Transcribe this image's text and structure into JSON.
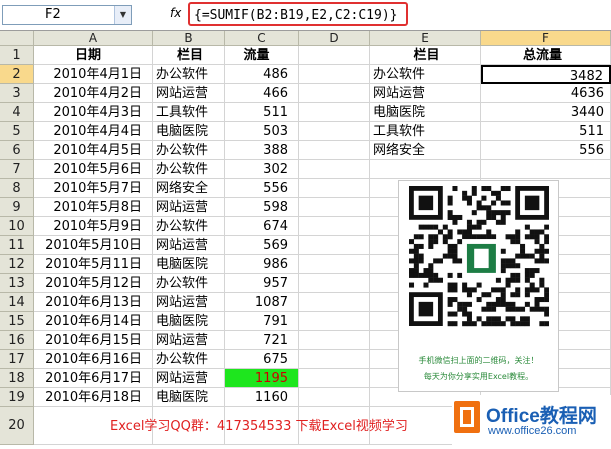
{
  "name_box": "F2",
  "fx_label": "fx",
  "formula": "{=SUMIF(B2:B19,E2,C2:C19)}",
  "columns": [
    "A",
    "B",
    "C",
    "D",
    "E",
    "F"
  ],
  "row_numbers": [
    "1",
    "2",
    "3",
    "4",
    "5",
    "6",
    "7",
    "8",
    "9",
    "10",
    "11",
    "12",
    "13",
    "14",
    "15",
    "16",
    "17",
    "18",
    "19",
    "20"
  ],
  "header_row": {
    "a": "日期",
    "b": "栏目",
    "c": "流量",
    "e": "栏目",
    "f": "总流量"
  },
  "rows": [
    {
      "a": "2010年4月1日",
      "b": "办公软件",
      "c": "486"
    },
    {
      "a": "2010年4月2日",
      "b": "网站运营",
      "c": "466"
    },
    {
      "a": "2010年4月3日",
      "b": "工具软件",
      "c": "511"
    },
    {
      "a": "2010年4月4日",
      "b": "电脑医院",
      "c": "503"
    },
    {
      "a": "2010年4月5日",
      "b": "办公软件",
      "c": "388"
    },
    {
      "a": "2010年5月6日",
      "b": "办公软件",
      "c": "302"
    },
    {
      "a": "2010年5月7日",
      "b": "网络安全",
      "c": "556"
    },
    {
      "a": "2010年5月8日",
      "b": "网站运营",
      "c": "598"
    },
    {
      "a": "2010年5月9日",
      "b": "办公软件",
      "c": "674"
    },
    {
      "a": "2010年5月10日",
      "b": "网站运营",
      "c": "569"
    },
    {
      "a": "2010年5月11日",
      "b": "电脑医院",
      "c": "986"
    },
    {
      "a": "2010年5月12日",
      "b": "办公软件",
      "c": "957"
    },
    {
      "a": "2010年6月13日",
      "b": "网站运营",
      "c": "1087"
    },
    {
      "a": "2010年6月14日",
      "b": "电脑医院",
      "c": "791"
    },
    {
      "a": "2010年6月15日",
      "b": "网站运营",
      "c": "721"
    },
    {
      "a": "2010年6月16日",
      "b": "办公软件",
      "c": "675"
    },
    {
      "a": "2010年6月17日",
      "b": "网站运营",
      "c": "1195"
    },
    {
      "a": "2010年6月18日",
      "b": "电脑医院",
      "c": "1160"
    }
  ],
  "summary": [
    {
      "e": "办公软件",
      "f": "3482"
    },
    {
      "e": "网站运营",
      "f": "4636"
    },
    {
      "e": "电脑医院",
      "f": "3440"
    },
    {
      "e": "工具软件",
      "f": "511"
    },
    {
      "e": "网络安全",
      "f": "556"
    }
  ],
  "qr_caption_1": "手机微信扫上面的二维码，关注！",
  "qr_caption_2": "每天为你分享实用Excel教程。",
  "footer_text": "Excel学习QQ群：417354533   下载Excel视频学习",
  "logo": {
    "brand": "Office教程网",
    "url": "www.office26.com"
  },
  "colors": {
    "highlight_green": "#1ee61e",
    "highlight_text": "#cc0000",
    "selected_header": "#f9d98c",
    "logo_orange": "#f07010",
    "logo_blue": "#1a5fb4"
  }
}
